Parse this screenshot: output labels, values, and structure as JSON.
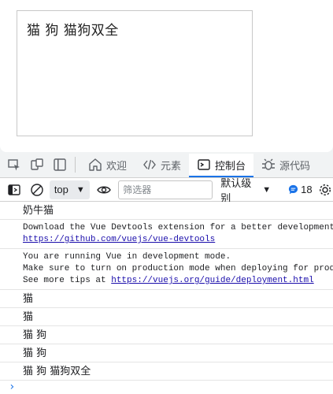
{
  "page": {
    "demo_text": "猫 狗 猫狗双全"
  },
  "devtools": {
    "tabs": [
      {
        "label": "欢迎",
        "icon": "home-icon"
      },
      {
        "label": "元素",
        "icon": "code-icon"
      },
      {
        "label": "控制台",
        "icon": "console-icon",
        "active": true
      },
      {
        "label": "源代码",
        "icon": "bug-icon"
      }
    ]
  },
  "toolbar": {
    "context": "top",
    "filter_placeholder": "筛选器",
    "levels_label": "默认级别",
    "message_count": "18"
  },
  "console": {
    "messages": [
      {
        "text": "奶牛猫"
      },
      {
        "lines": [
          "Download the Vue Devtools extension for a better development experience:"
        ],
        "link": "https://github.com/vuejs/vue-devtools"
      },
      {
        "lines": [
          "You are running Vue in development mode.",
          "Make sure to turn on production mode when deploying for production."
        ],
        "link_prefix": "See more tips at ",
        "link": "https://vuejs.org/guide/deployment.html"
      },
      {
        "text": "猫"
      },
      {
        "text": "猫"
      },
      {
        "text": "猫 狗"
      },
      {
        "text": "猫 狗"
      },
      {
        "text": "猫 狗 猫狗双全"
      }
    ],
    "prompt": "›"
  },
  "colors": {
    "accent": "#1a73e8",
    "link": "#1a0dab"
  }
}
